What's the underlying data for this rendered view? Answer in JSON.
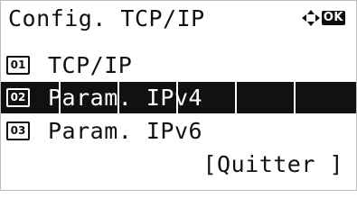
{
  "screen": {
    "title": "Config. TCP/IP",
    "ok_label": "OK",
    "menu": [
      {
        "number": "01",
        "label": "TCP/IP",
        "selected": false
      },
      {
        "number": "02",
        "label": "Param. IPv4",
        "selected": true
      },
      {
        "number": "03",
        "label": "Param. IPv6",
        "selected": false
      }
    ],
    "quit_label": "[Quitter ]"
  }
}
